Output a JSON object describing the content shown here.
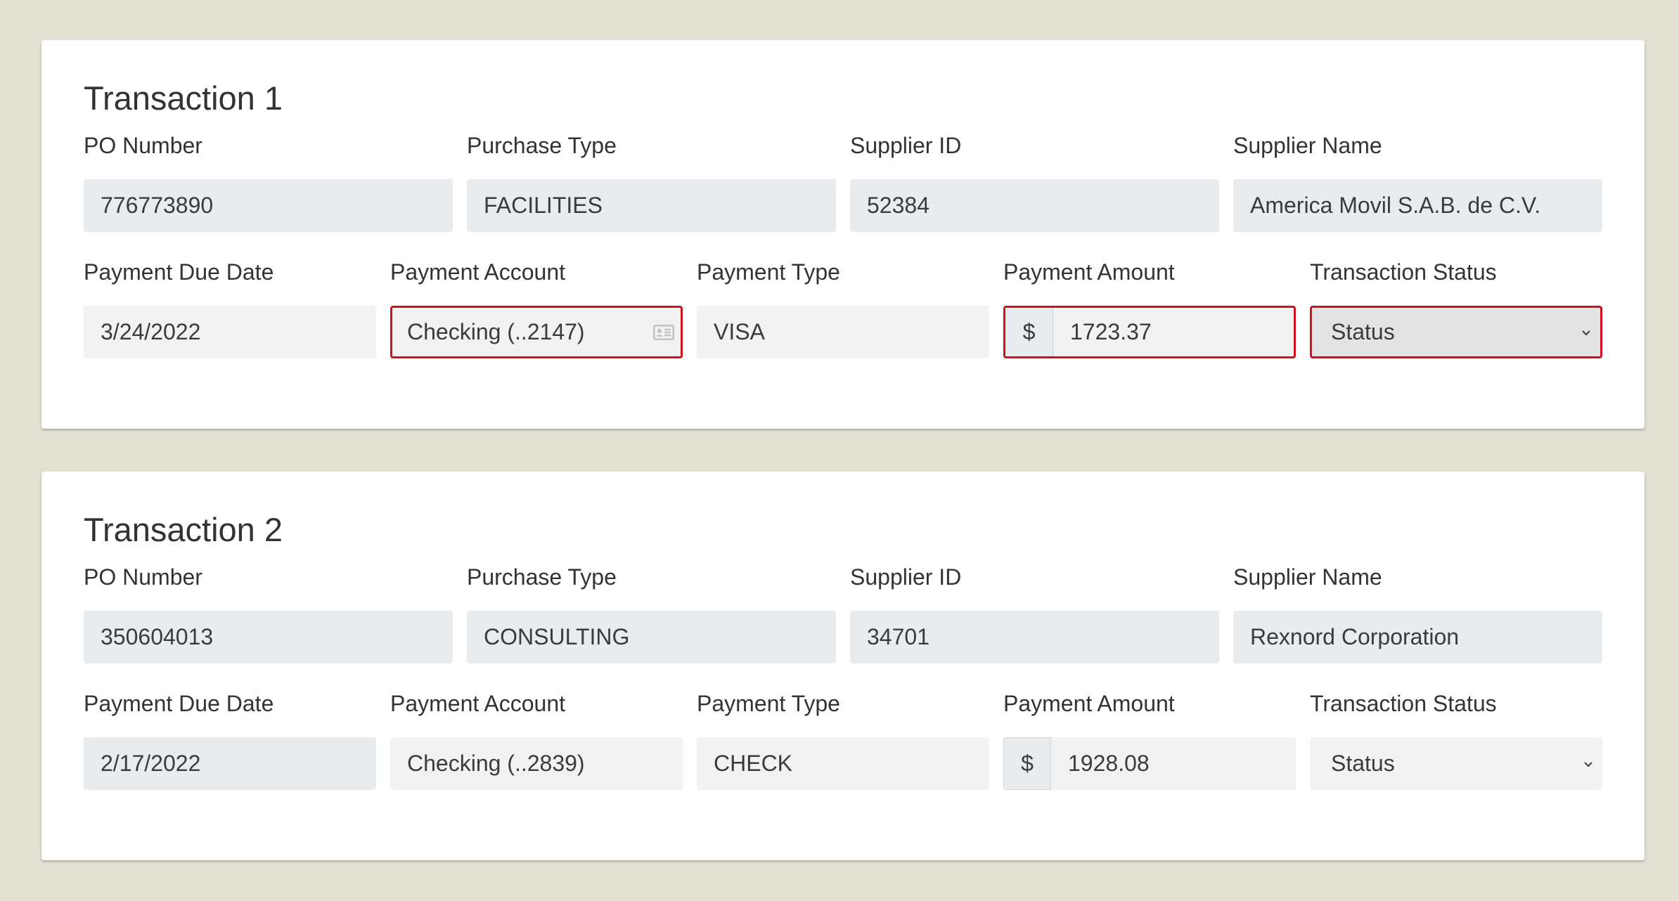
{
  "transactions": [
    {
      "title": "Transaction 1",
      "labels": {
        "po_number": "PO Number",
        "purchase_type": "Purchase Type",
        "supplier_id": "Supplier ID",
        "supplier_name": "Supplier Name",
        "payment_due_date": "Payment Due Date",
        "payment_account": "Payment Account",
        "payment_type": "Payment Type",
        "payment_amount": "Payment Amount",
        "transaction_status": "Transaction Status"
      },
      "values": {
        "po_number": "776773890",
        "purchase_type": "FACILITIES",
        "supplier_id": "52384",
        "supplier_name": "America Movil S.A.B. de C.V.",
        "payment_due_date": "3/24/2022",
        "payment_account": "Checking (..2147)",
        "payment_type": "VISA",
        "currency_symbol": "$",
        "payment_amount": "1723.37",
        "transaction_status": "Status"
      },
      "account_icon": "contact-card-icon",
      "error_color": "#d0111c"
    },
    {
      "title": "Transaction 2",
      "labels": {
        "po_number": "PO Number",
        "purchase_type": "Purchase Type",
        "supplier_id": "Supplier ID",
        "supplier_name": "Supplier Name",
        "payment_due_date": "Payment Due Date",
        "payment_account": "Payment Account",
        "payment_type": "Payment Type",
        "payment_amount": "Payment Amount",
        "transaction_status": "Transaction Status"
      },
      "values": {
        "po_number": "350604013",
        "purchase_type": "CONSULTING",
        "supplier_id": "34701",
        "supplier_name": "Rexnord Corporation",
        "payment_due_date": "2/17/2022",
        "payment_account": "Checking (..2839)",
        "payment_type": "CHECK",
        "currency_symbol": "$",
        "payment_amount": "1928.08",
        "transaction_status": "Status"
      }
    }
  ]
}
